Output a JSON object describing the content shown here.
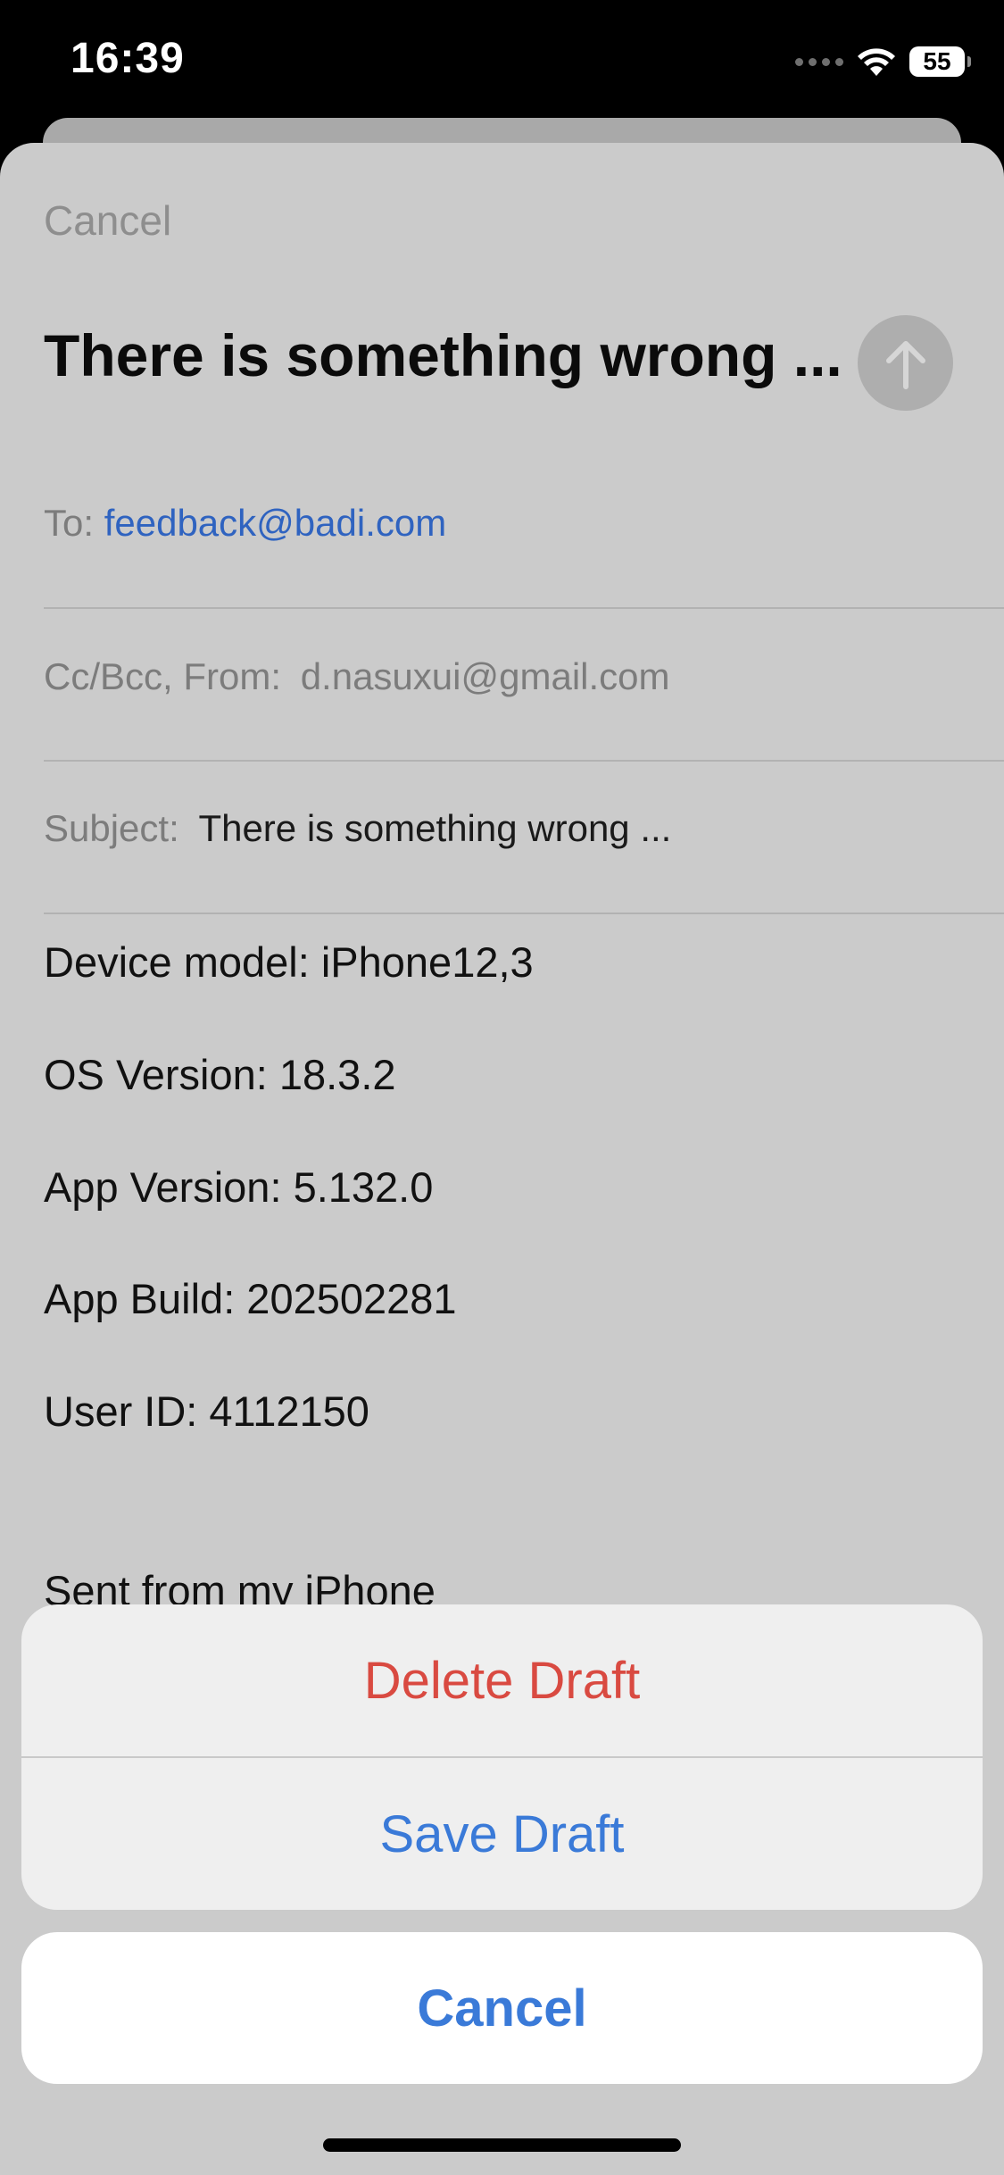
{
  "status_bar": {
    "time": "16:39",
    "battery": "55",
    "icons": [
      "signal-dots-icon",
      "wifi-icon",
      "battery-icon"
    ]
  },
  "compose": {
    "cancel_label": "Cancel",
    "title": "There is something wrong ...",
    "send_icon": "arrow-up-icon",
    "to_label": "To:",
    "to_value": "feedback@badi.com",
    "ccbcc_label": "Cc/Bcc, From:",
    "from_value": "d.nasuxui@gmail.com",
    "subject_label": "Subject:",
    "subject_value": "There is something wrong ...",
    "body_lines": [
      "Device model: iPhone12,3",
      "OS Version: 18.3.2",
      "App Version: 5.132.0",
      "App Build: 202502281",
      "User ID: 4112150",
      "Sent from my iPhone"
    ]
  },
  "action_sheet": {
    "delete_label": "Delete Draft",
    "save_label": "Save Draft",
    "cancel_label": "Cancel"
  },
  "colors": {
    "destructive": "#d94a41",
    "accent": "#3a7ad8",
    "link": "#2f63c0"
  }
}
